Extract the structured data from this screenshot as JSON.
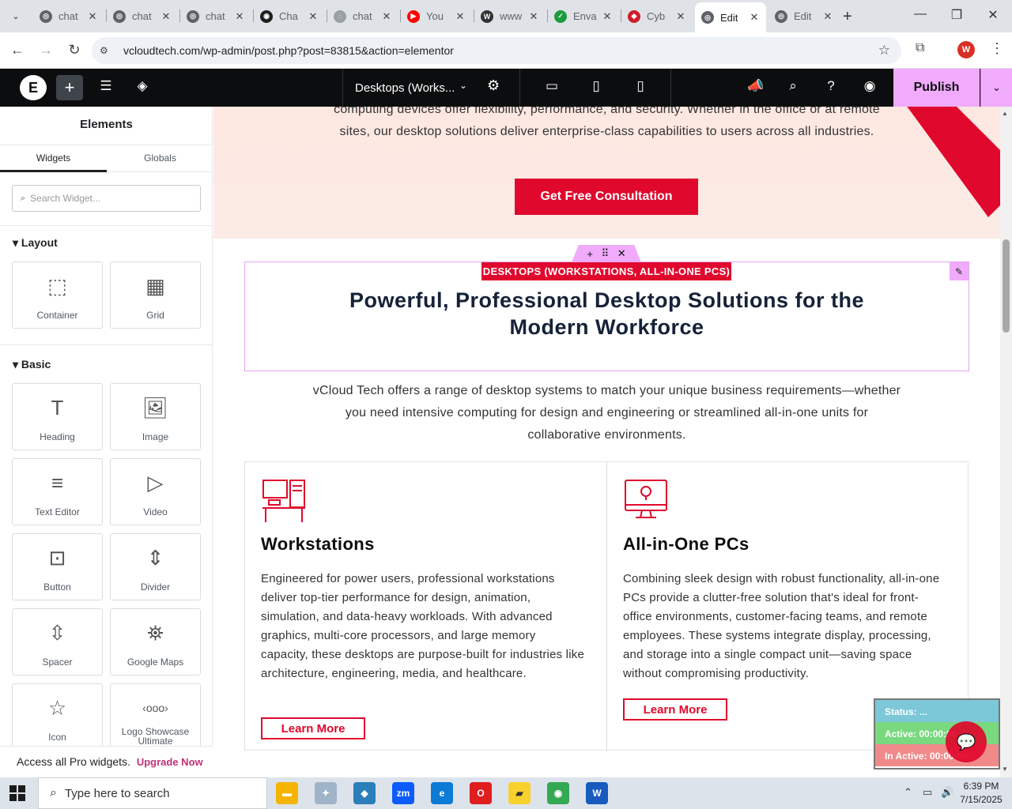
{
  "browser": {
    "tabs": [
      {
        "title": "chat",
        "icon_color": "#5f6368",
        "icon_glyph": "◎"
      },
      {
        "title": "chat",
        "icon_color": "#5f6368",
        "icon_glyph": "◎"
      },
      {
        "title": "chat",
        "icon_color": "#5f6368",
        "icon_glyph": "◎"
      },
      {
        "title": "Cha",
        "icon_color": "#1f1f1f",
        "icon_glyph": "◉"
      },
      {
        "title": "chat",
        "icon_color": "#9aa0a6",
        "icon_glyph": "◌"
      },
      {
        "title": "You",
        "icon_color": "#ff0000",
        "icon_glyph": "▶"
      },
      {
        "title": "www",
        "icon_color": "#333333",
        "icon_glyph": "W"
      },
      {
        "title": "Enva",
        "icon_color": "#1a9c3c",
        "icon_glyph": "✓"
      },
      {
        "title": "Cyb",
        "icon_color": "#d01c2a",
        "icon_glyph": "◆"
      },
      {
        "title": "Edit",
        "icon_color": "#5f6368",
        "icon_glyph": "◎",
        "active": true
      },
      {
        "title": "Edit",
        "icon_color": "#5f6368",
        "icon_glyph": "◎"
      }
    ],
    "url": "vcloudtech.com/wp-admin/post.php?post=83815&action=elementor",
    "profile_initial": "W"
  },
  "editor": {
    "document_title": "Desktops (Works...",
    "publish_label": "Publish",
    "panel_title": "Elements",
    "tabs": [
      "Widgets",
      "Globals"
    ],
    "search_placeholder": "Search Widget...",
    "sections": [
      {
        "title": "Layout",
        "widgets": [
          {
            "label": "Container",
            "icon": "container-icon",
            "glyph": "⬚"
          },
          {
            "label": "Grid",
            "icon": "grid-icon",
            "glyph": "▦"
          }
        ]
      },
      {
        "title": "Basic",
        "widgets": [
          {
            "label": "Heading",
            "icon": "heading-icon",
            "glyph": "T"
          },
          {
            "label": "Image",
            "icon": "image-icon",
            "glyph": "🖼"
          },
          {
            "label": "Text Editor",
            "icon": "text-editor-icon",
            "glyph": "≡"
          },
          {
            "label": "Video",
            "icon": "video-icon",
            "glyph": "▷"
          },
          {
            "label": "Button",
            "icon": "button-icon",
            "glyph": "⊡"
          },
          {
            "label": "Divider",
            "icon": "divider-icon",
            "glyph": "⇕"
          },
          {
            "label": "Spacer",
            "icon": "spacer-icon",
            "glyph": "⇳"
          },
          {
            "label": "Google Maps",
            "icon": "google-maps-icon",
            "glyph": "⛯"
          },
          {
            "label": "Icon",
            "icon": "icon-widget-icon",
            "glyph": "☆"
          },
          {
            "label": "Logo Showcase Ultimate",
            "icon": "logo-showcase-icon",
            "glyph": "‹ooo›"
          }
        ]
      }
    ],
    "footer_text": "Access all Pro widgets.",
    "footer_link": "Upgrade Now"
  },
  "page": {
    "hero_text": "computing devices offer flexibility, performance, and security. Whether in the office or at remote sites, our desktop solutions deliver enterprise-class capabilities to users across all industries.",
    "cta_label": "Get Free Consultation",
    "badge": "DESKTOPS (WORKSTATIONS, ALL-IN-ONE PCS)",
    "heading": "Powerful, Professional Desktop Solutions for the Modern Workforce",
    "intro": "vCloud Tech offers a range of desktop systems to match your unique business requirements—whether you need intensive computing for design and engineering or streamlined all-in-one units for collaborative environments.",
    "cards": [
      {
        "title": "Workstations",
        "body": "Engineered for power users, professional workstations deliver top-tier performance for design, animation, simulation, and data-heavy workloads. With advanced graphics, multi-core processors, and large memory capacity, these desktops are purpose-built for industries like architecture, engineering, media, and healthcare.",
        "button": "Learn More"
      },
      {
        "title": "All-in-One PCs",
        "body": "Combining sleek design with robust functionality, all-in-one PCs provide a clutter-free solution that's ideal for front-office environments, customer-facing teams, and remote employees. These systems integrate display, processing, and storage into a single compact unit—saving space without compromising productivity.",
        "button": "Learn More"
      }
    ],
    "accent": "#e0082d"
  },
  "status_widget": {
    "status": "Status: ...",
    "active": "Active: 00:00:00",
    "inactive": "In Active: 00:00:00"
  },
  "taskbar": {
    "search_placeholder": "Type here to search",
    "time": "6:39 PM",
    "date": "7/15/2025"
  }
}
